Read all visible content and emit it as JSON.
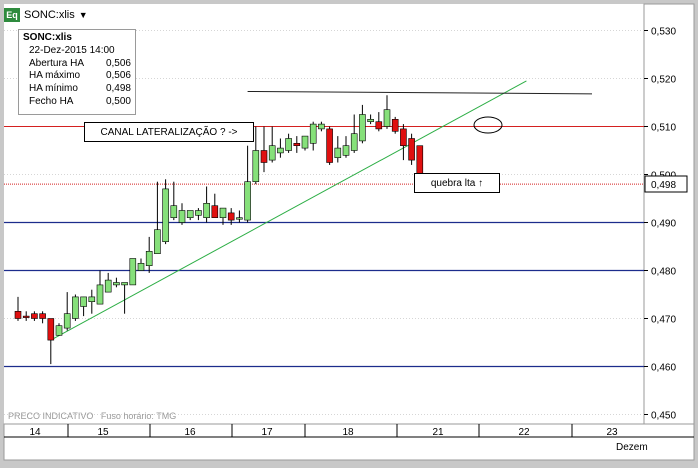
{
  "window": {
    "icon_label": "Eq",
    "symbol": "SONC:xlis",
    "dropdown_glyph": "▼"
  },
  "info_box": {
    "title": "SONC:xlis",
    "datetime": "22-Dez-2015 14:00",
    "rows": [
      {
        "label": "Abertura HA",
        "value": "0,506"
      },
      {
        "label": "HA máximo",
        "value": "0,506"
      },
      {
        "label": "HA mínimo",
        "value": "0,498"
      },
      {
        "label": "Fecho HA",
        "value": "0,500"
      }
    ]
  },
  "annotations": {
    "canal": "CANAL LATERALIZAÇÃO ?   ->",
    "quebra": "quebra lta ↑"
  },
  "footer": {
    "indicator": "PRECO INDICATIVO",
    "timezone": "Fuso horário: TMG"
  },
  "colors": {
    "bull": "#86e07a",
    "bear": "#e01010",
    "hline_red": "#d42020",
    "hline_blue": "#1c2c8c",
    "trend": "#2cae45",
    "resistance": "#222222",
    "bg": "#ffffff",
    "panel": "#c8c8c8"
  },
  "chart_data": {
    "type": "candlestick",
    "y_axis": {
      "min": 0.45,
      "max": 0.535,
      "ticks": [
        "0,530",
        "0,520",
        "0,510",
        "0,500",
        "0,490",
        "0,480",
        "0,470",
        "0,460",
        "0,450"
      ],
      "side": "right"
    },
    "x_axis": {
      "labels": [
        "14",
        "15",
        "16",
        "17",
        "18",
        "21",
        "22",
        "23"
      ],
      "trailing_label": "Dezem"
    },
    "current_price_label": "0,498",
    "horizontal_levels": [
      {
        "value": 0.51,
        "color": "red",
        "label": "0,510"
      },
      {
        "value": 0.49,
        "color": "blue",
        "label": "0,490"
      },
      {
        "value": 0.48,
        "color": "blue",
        "label": "0,480"
      },
      {
        "value": 0.46,
        "color": "blue",
        "label": "0,460"
      },
      {
        "value": 0.498,
        "color": "red-dotted",
        "label": "0,498"
      }
    ],
    "candles": [
      {
        "day": "14",
        "open": 0.4715,
        "close": 0.47,
        "high": 0.4745,
        "low": 0.4695,
        "dir": "down"
      },
      {
        "day": "14",
        "open": 0.4705,
        "close": 0.4705,
        "high": 0.4715,
        "low": 0.4695,
        "dir": "down"
      },
      {
        "day": "14",
        "open": 0.471,
        "close": 0.47,
        "high": 0.4715,
        "low": 0.4695,
        "dir": "down"
      },
      {
        "day": "14",
        "open": 0.471,
        "close": 0.47,
        "high": 0.4715,
        "low": 0.469,
        "dir": "down"
      },
      {
        "day": "14",
        "open": 0.47,
        "close": 0.4655,
        "high": 0.47,
        "low": 0.4605,
        "dir": "down"
      },
      {
        "day": "15",
        "open": 0.4665,
        "close": 0.4685,
        "high": 0.469,
        "low": 0.4665,
        "dir": "up"
      },
      {
        "day": "15",
        "open": 0.468,
        "close": 0.471,
        "high": 0.4755,
        "low": 0.4675,
        "dir": "up"
      },
      {
        "day": "15",
        "open": 0.47,
        "close": 0.4745,
        "high": 0.475,
        "low": 0.4695,
        "dir": "up"
      },
      {
        "day": "15",
        "open": 0.4725,
        "close": 0.4745,
        "high": 0.4745,
        "low": 0.4705,
        "dir": "up"
      },
      {
        "day": "15",
        "open": 0.4735,
        "close": 0.4745,
        "high": 0.476,
        "low": 0.471,
        "dir": "up"
      },
      {
        "day": "15",
        "open": 0.473,
        "close": 0.477,
        "high": 0.48,
        "low": 0.473,
        "dir": "up"
      },
      {
        "day": "15",
        "open": 0.4755,
        "close": 0.478,
        "high": 0.4795,
        "low": 0.4755,
        "dir": "up"
      },
      {
        "day": "15",
        "open": 0.477,
        "close": 0.4775,
        "high": 0.4785,
        "low": 0.4765,
        "dir": "up"
      },
      {
        "day": "15",
        "open": 0.477,
        "close": 0.4775,
        "high": 0.4775,
        "low": 0.471,
        "dir": "up"
      },
      {
        "day": "16",
        "open": 0.477,
        "close": 0.4825,
        "high": 0.4825,
        "low": 0.477,
        "dir": "up"
      },
      {
        "day": "16",
        "open": 0.48,
        "close": 0.4815,
        "high": 0.4825,
        "low": 0.48,
        "dir": "up"
      },
      {
        "day": "16",
        "open": 0.481,
        "close": 0.484,
        "high": 0.487,
        "low": 0.4795,
        "dir": "up"
      },
      {
        "day": "16",
        "open": 0.4835,
        "close": 0.4885,
        "high": 0.4985,
        "low": 0.4835,
        "dir": "up"
      },
      {
        "day": "16",
        "open": 0.486,
        "close": 0.497,
        "high": 0.499,
        "low": 0.4855,
        "dir": "up"
      },
      {
        "day": "16",
        "open": 0.491,
        "close": 0.4935,
        "high": 0.4985,
        "low": 0.4905,
        "dir": "up"
      },
      {
        "day": "16",
        "open": 0.49,
        "close": 0.4925,
        "high": 0.494,
        "low": 0.4895,
        "dir": "up"
      },
      {
        "day": "16",
        "open": 0.491,
        "close": 0.4925,
        "high": 0.4925,
        "low": 0.4905,
        "dir": "up"
      },
      {
        "day": "17",
        "open": 0.4915,
        "close": 0.4925,
        "high": 0.493,
        "low": 0.4905,
        "dir": "up"
      },
      {
        "day": "17",
        "open": 0.491,
        "close": 0.494,
        "high": 0.4975,
        "low": 0.49,
        "dir": "up"
      },
      {
        "day": "17",
        "open": 0.4935,
        "close": 0.491,
        "high": 0.496,
        "low": 0.491,
        "dir": "down"
      },
      {
        "day": "17",
        "open": 0.491,
        "close": 0.493,
        "high": 0.493,
        "low": 0.4895,
        "dir": "up"
      },
      {
        "day": "17",
        "open": 0.492,
        "close": 0.4905,
        "high": 0.493,
        "low": 0.4895,
        "dir": "down"
      },
      {
        "day": "17",
        "open": 0.491,
        "close": 0.491,
        "high": 0.4925,
        "low": 0.49,
        "dir": "up"
      },
      {
        "day": "17",
        "open": 0.4905,
        "close": 0.4985,
        "high": 0.506,
        "low": 0.49,
        "dir": "up"
      },
      {
        "day": "18",
        "open": 0.4985,
        "close": 0.505,
        "high": 0.51,
        "low": 0.498,
        "dir": "up"
      },
      {
        "day": "18",
        "open": 0.505,
        "close": 0.5025,
        "high": 0.51,
        "low": 0.5005,
        "dir": "down"
      },
      {
        "day": "18",
        "open": 0.503,
        "close": 0.506,
        "high": 0.51,
        "low": 0.5025,
        "dir": "up"
      },
      {
        "day": "18",
        "open": 0.5045,
        "close": 0.5055,
        "high": 0.5075,
        "low": 0.5035,
        "dir": "up"
      },
      {
        "day": "18",
        "open": 0.505,
        "close": 0.5075,
        "high": 0.5085,
        "low": 0.5045,
        "dir": "up"
      },
      {
        "day": "18",
        "open": 0.5065,
        "close": 0.506,
        "high": 0.508,
        "low": 0.5045,
        "dir": "down"
      },
      {
        "day": "18",
        "open": 0.5055,
        "close": 0.508,
        "high": 0.508,
        "low": 0.505,
        "dir": "up"
      },
      {
        "day": "18",
        "open": 0.5065,
        "close": 0.5105,
        "high": 0.511,
        "low": 0.505,
        "dir": "up"
      },
      {
        "day": "18",
        "open": 0.5095,
        "close": 0.5105,
        "high": 0.511,
        "low": 0.509,
        "dir": "up"
      },
      {
        "day": "21",
        "open": 0.5095,
        "close": 0.5025,
        "high": 0.51,
        "low": 0.502,
        "dir": "down"
      },
      {
        "day": "21",
        "open": 0.5035,
        "close": 0.5055,
        "high": 0.508,
        "low": 0.5025,
        "dir": "up"
      },
      {
        "day": "21",
        "open": 0.504,
        "close": 0.506,
        "high": 0.508,
        "low": 0.5035,
        "dir": "up"
      },
      {
        "day": "21",
        "open": 0.505,
        "close": 0.5085,
        "high": 0.5125,
        "low": 0.5045,
        "dir": "up"
      },
      {
        "day": "21",
        "open": 0.507,
        "close": 0.5125,
        "high": 0.5145,
        "low": 0.5065,
        "dir": "up"
      },
      {
        "day": "21",
        "open": 0.511,
        "close": 0.5115,
        "high": 0.5125,
        "low": 0.5105,
        "dir": "up"
      },
      {
        "day": "21",
        "open": 0.511,
        "close": 0.5095,
        "high": 0.513,
        "low": 0.509,
        "dir": "down"
      },
      {
        "day": "21",
        "open": 0.51,
        "close": 0.5135,
        "high": 0.5165,
        "low": 0.5095,
        "dir": "up"
      },
      {
        "day": "22",
        "open": 0.5115,
        "close": 0.509,
        "high": 0.512,
        "low": 0.5085,
        "dir": "down"
      },
      {
        "day": "22",
        "open": 0.5095,
        "close": 0.506,
        "high": 0.5105,
        "low": 0.503,
        "dir": "down"
      },
      {
        "day": "22",
        "open": 0.5075,
        "close": 0.503,
        "high": 0.5085,
        "low": 0.502,
        "dir": "down"
      },
      {
        "day": "22",
        "open": 0.506,
        "close": 0.5,
        "high": 0.506,
        "low": 0.498,
        "dir": "down"
      }
    ],
    "lines": [
      {
        "kind": "uptrend",
        "from": {
          "candle": 4,
          "price": 0.4655
        },
        "to": {
          "candle": 62,
          "price": 0.5195
        }
      },
      {
        "kind": "resistance",
        "from": {
          "candle": 28,
          "price": 0.5173
        },
        "to": {
          "candle": 70,
          "price": 0.5168
        }
      }
    ]
  }
}
